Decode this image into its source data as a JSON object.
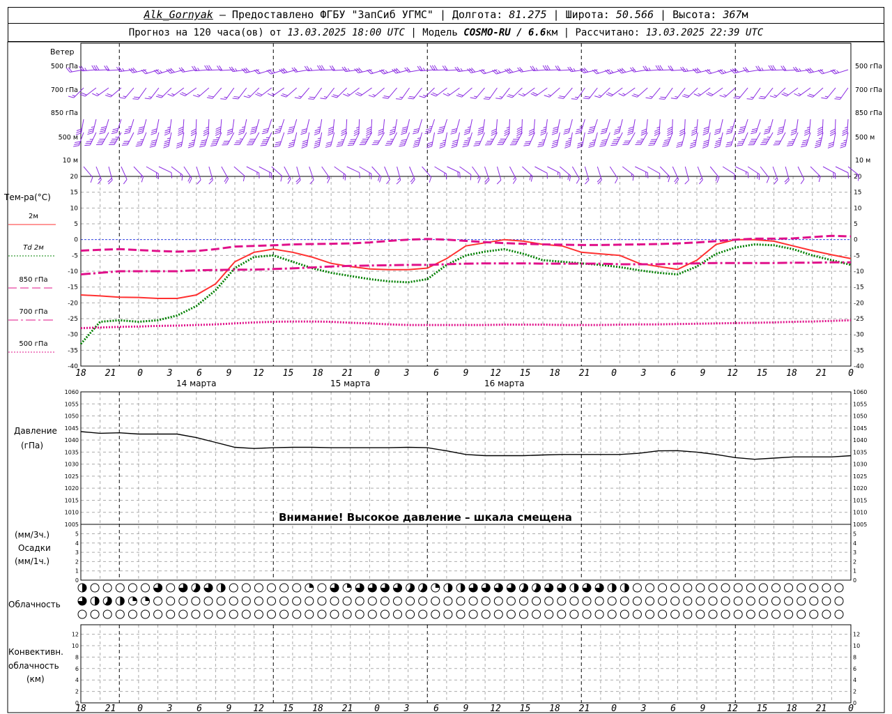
{
  "header": {
    "station": "Alk_Gornyak",
    "provider": "– Предоставлено ФГБУ \"ЗапСиб УГМС\"",
    "lon_label": "Долгота:",
    "lon": "81.275",
    "lat_label": "Широта:",
    "lat": "50.566",
    "alt_label": "Высота:",
    "alt": "367",
    "alt_unit": "м",
    "forecast_label": "Прогноз на 120 часа(ов) от",
    "forecast_time": "13.03.2025 18:00 UTC",
    "model_label": "Модель",
    "model": "COSMO-RU / 6.6",
    "model_unit": "км",
    "computed_label": "Рассчитано:",
    "computed_time": "13.03.2025 22:39 UTC"
  },
  "wind_panel": {
    "title": "Ветер",
    "levels": [
      "500 гПа",
      "700 гПа",
      "850 гПа",
      "500 м",
      "10 м"
    ]
  },
  "temp_panel": {
    "title": "Тем-ра(°С)",
    "legend": [
      {
        "label": "2м",
        "color": "#ff3030"
      },
      {
        "label": "Td 2м",
        "color": "#008000"
      },
      {
        "label": "850 гПа",
        "color": "#e0108a"
      },
      {
        "label": "700 гПа",
        "color": "#e0108a"
      },
      {
        "label": "500 гПа",
        "color": "#e0108a"
      }
    ]
  },
  "time_axis": {
    "ticks": [
      "18",
      "21",
      "0",
      "3",
      "6",
      "9",
      "12",
      "15",
      "18",
      "21",
      "0",
      "3",
      "6",
      "9",
      "12",
      "15",
      "18",
      "21",
      "0",
      "3",
      "6",
      "9",
      "12",
      "15",
      "18",
      "21",
      "0"
    ],
    "day_labels": [
      "14 марта",
      "15 марта",
      "16 марта"
    ]
  },
  "pressure_panel": {
    "title": "Давление",
    "unit": "(гПа)",
    "warning": "Внимание! Высокое давление – шкала смещена"
  },
  "precip_panel": {
    "unit3": "(мм/3ч.)",
    "title": "Осадки",
    "unit1": "(мм/1ч.)"
  },
  "cloud_panel": {
    "title": "Облачность"
  },
  "conv_panel": {
    "title1": "Конвективн.",
    "title2": "облачность",
    "unit": "(км)"
  },
  "chart_data": [
    {
      "type": "line",
      "x_hours": [
        0,
        3,
        6,
        9,
        12,
        15,
        18,
        21,
        24,
        27,
        30,
        33,
        36,
        39,
        42,
        45,
        48,
        51,
        54,
        57,
        60,
        63,
        66,
        69,
        72,
        75,
        78,
        81,
        84,
        87,
        90,
        93,
        96,
        99,
        102,
        105,
        108,
        111,
        114,
        117,
        120
      ],
      "ylim": [
        -40,
        20
      ],
      "yticks": [
        -40,
        -35,
        -30,
        -25,
        -20,
        -15,
        -10,
        -5,
        0,
        5,
        10,
        15,
        20
      ],
      "series": [
        {
          "name": "2м",
          "color": "#ff3030",
          "style": "solid",
          "values": [
            -17.5,
            -17.8,
            -18.2,
            -18.3,
            -18.6,
            -18.6,
            -17.5,
            -14,
            -7,
            -4,
            -3,
            -4,
            -5.5,
            -7.5,
            -8.5,
            -9.3,
            -9.5,
            -9.5,
            -9,
            -6,
            -2,
            -1,
            0,
            -0.5,
            -1.5,
            -2,
            -4,
            -4.5,
            -5,
            -7.5,
            -8.5,
            -9.4,
            -6.5,
            -1.5,
            0,
            0,
            -0.5,
            -2,
            -3.5,
            -4.8,
            -6
          ]
        },
        {
          "name": "Td 2м",
          "color": "#008000",
          "style": "dotted",
          "values": [
            -33,
            -26,
            -25.5,
            -26,
            -25.5,
            -24,
            -21,
            -16,
            -9,
            -5.5,
            -5,
            -7,
            -9,
            -10.5,
            -11.5,
            -12.5,
            -13.2,
            -13.5,
            -12.5,
            -8,
            -5,
            -3.8,
            -3,
            -4.5,
            -6.5,
            -7,
            -7.5,
            -8,
            -8.7,
            -9.7,
            -10.5,
            -11,
            -8.5,
            -4.5,
            -2.5,
            -1.5,
            -1.8,
            -3,
            -5,
            -6.5,
            -8
          ]
        },
        {
          "name": "850 гПа",
          "color": "#e0108a",
          "style": "dashed",
          "values": [
            -3.5,
            -3.2,
            -3,
            -3.3,
            -3.6,
            -3.8,
            -3.6,
            -3,
            -2.2,
            -2,
            -1.8,
            -1.5,
            -1.4,
            -1.3,
            -1.2,
            -0.9,
            -0.4,
            0,
            0.2,
            0,
            -0.4,
            -0.8,
            -1.1,
            -1.3,
            -1.5,
            -1.6,
            -1.7,
            -1.7,
            -1.6,
            -1.5,
            -1.4,
            -1.2,
            -0.9,
            -0.5,
            0,
            0.3,
            0.3,
            0.4,
            0.8,
            1.2,
            1
          ]
        },
        {
          "name": "700 гПа",
          "color": "#e0108a",
          "style": "dashdot",
          "values": [
            -11,
            -10.5,
            -10,
            -10,
            -10,
            -10,
            -9.7,
            -9.6,
            -9.5,
            -9.5,
            -9.3,
            -9.1,
            -8.8,
            -8.5,
            -8.3,
            -8.2,
            -8.1,
            -8,
            -8,
            -7.8,
            -7.6,
            -7.5,
            -7.5,
            -7.5,
            -7.6,
            -7.6,
            -7.6,
            -7.6,
            -7.8,
            -7.8,
            -7.8,
            -7.6,
            -7.5,
            -7.4,
            -7.4,
            -7.4,
            -7.4,
            -7.3,
            -7.3,
            -7.2,
            -7.2
          ]
        },
        {
          "name": "500 гПа",
          "color": "#e0108a",
          "style": "dotted",
          "values": [
            -28,
            -27.8,
            -27.6,
            -27.5,
            -27.3,
            -27.2,
            -27,
            -26.8,
            -26.5,
            -26.2,
            -26,
            -25.9,
            -25.9,
            -26,
            -26.3,
            -26.5,
            -26.8,
            -27,
            -27,
            -27,
            -27,
            -27,
            -26.9,
            -26.9,
            -26.9,
            -27,
            -27,
            -27,
            -26.9,
            -26.8,
            -26.8,
            -26.7,
            -26.6,
            -26.5,
            -26.4,
            -26.3,
            -26.2,
            -26,
            -25.9,
            -25.7,
            -25.5
          ]
        }
      ]
    },
    {
      "type": "line",
      "x_hours": [
        0,
        3,
        6,
        9,
        12,
        15,
        18,
        21,
        24,
        27,
        30,
        33,
        36,
        39,
        42,
        45,
        48,
        51,
        54,
        57,
        60,
        63,
        66,
        69,
        72,
        75,
        78,
        81,
        84,
        87,
        90,
        93,
        96,
        99,
        102,
        105,
        108,
        111,
        114,
        117,
        120
      ],
      "ylim": [
        1005,
        1060
      ],
      "yticks": [
        1005,
        1010,
        1015,
        1020,
        1025,
        1030,
        1035,
        1040,
        1045,
        1050,
        1055,
        1060
      ],
      "series": [
        {
          "name": "",
          "color": "#000000",
          "style": "solid",
          "values": [
            1043.5,
            1042.8,
            1043,
            1042.5,
            1042.5,
            1042.5,
            1041,
            1039,
            1037,
            1036.5,
            1036.8,
            1037,
            1037,
            1036.8,
            1036.8,
            1036.8,
            1036.8,
            1037,
            1036.8,
            1035.5,
            1034,
            1033.5,
            1033.5,
            1033.5,
            1033.8,
            1034,
            1034,
            1034,
            1034,
            1034.5,
            1035.5,
            1035.6,
            1035,
            1034,
            1032.7,
            1032,
            1032.5,
            1033,
            1033,
            1033,
            1033.5
          ]
        }
      ]
    },
    {
      "type": "scatter",
      "title": "Облачность",
      "rows": 3,
      "note": "cloud cover symbols per hour (0=clear, 1=full)",
      "row1_fraction": [
        0.5,
        0,
        0,
        0,
        0,
        0,
        0,
        0,
        0,
        0,
        0,
        0.25,
        0.75,
        0.75,
        0,
        0.75,
        0.75,
        0.75,
        0.6,
        0.75,
        0.75,
        0.75,
        0.5,
        0,
        0,
        0,
        0,
        0,
        0,
        0,
        0,
        0,
        0,
        0,
        0,
        0,
        0.25,
        0.5,
        0,
        0.25,
        0.75,
        0,
        0.25,
        0.5,
        0.75,
        0.5,
        0.75,
        0.6,
        0.75,
        0.75,
        0.75,
        0.75,
        0.6,
        0.5,
        0.6,
        0,
        0.25,
        0.5,
        0.5,
        0.75,
        0.5,
        0.6,
        0.75,
        0.75,
        0.75,
        0.75,
        0.75,
        0.75,
        0.75,
        0.75,
        0.6,
        0.75,
        0.6,
        0.75,
        0.75,
        0.75,
        0.75,
        0.75,
        0.5,
        0.75,
        0.75,
        0.5,
        0.75,
        0.75,
        0.5,
        0.5,
        0.5,
        0.25,
        0,
        0,
        0,
        0,
        0,
        0,
        0,
        0,
        0,
        0,
        0,
        0,
        0,
        0,
        0,
        0,
        0,
        0,
        0,
        0,
        0,
        0,
        0,
        0,
        0,
        0,
        0,
        0,
        0,
        0,
        0,
        0,
        0,
        0,
        0,
        0,
        0,
        0,
        0,
        0,
        0
      ],
      "row2_fraction": [
        0.75,
        0.5,
        0.5,
        0.75,
        0.6,
        0.25,
        0.5,
        0.75,
        0.25,
        0.25,
        0.25,
        0,
        0,
        0,
        0,
        0,
        0,
        0,
        0,
        0,
        0,
        0,
        0,
        0,
        0,
        0,
        0,
        0,
        0,
        0,
        0,
        0,
        0,
        0,
        0,
        0,
        0,
        0,
        0,
        0.6,
        0,
        0,
        0,
        0,
        0,
        0,
        0,
        0,
        0,
        0,
        0,
        0,
        0,
        0,
        0,
        0,
        0,
        0,
        0,
        0,
        0,
        0,
        0,
        0,
        0,
        0,
        0,
        0,
        0,
        0,
        0,
        0,
        0,
        0,
        0,
        0,
        0,
        0,
        0,
        0,
        0,
        0,
        0,
        0,
        0,
        0,
        0,
        0,
        0,
        0,
        0,
        0,
        0,
        0,
        0,
        0,
        0,
        0,
        0,
        0,
        0,
        0,
        0,
        0,
        0,
        0,
        0,
        0,
        0,
        0,
        0,
        0,
        0,
        0,
        0,
        0,
        0,
        0,
        0,
        0,
        0
      ],
      "row3_fraction": [
        0
      ]
    }
  ]
}
